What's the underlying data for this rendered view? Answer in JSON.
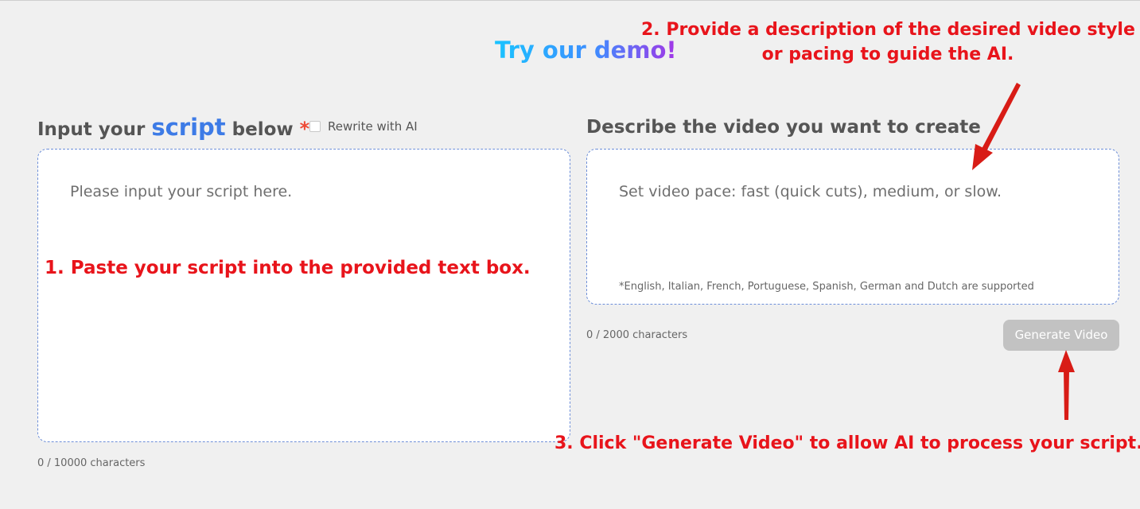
{
  "demo_title": "Try our demo!",
  "left_panel": {
    "title_prefix": "Input your",
    "title_keyword": "script",
    "title_suffix": "below",
    "required_mark": "*",
    "rewrite_label": "Rewrite with AI",
    "placeholder": "Please input your script here.",
    "char_count": "0 / 10000 characters"
  },
  "right_panel": {
    "title": "Describe the video you want to create",
    "placeholder": "Set video pace: fast (quick cuts), medium, or slow.",
    "support_note": "*English, Italian, French, Portuguese, Spanish, German and Dutch are supported",
    "char_count": "0 / 2000 characters",
    "generate_label": "Generate Video"
  },
  "annotations": {
    "step1": "1. Paste your script into the provided text box.",
    "step2_line1": "2. Provide a description of the desired video style",
    "step2_line2": "or pacing to guide the AI.",
    "step3": "3.  Click \"Generate Video\" to allow AI to process your script."
  },
  "colors": {
    "background": "#f0f0f0",
    "annotation_red": "#e8141b",
    "keyword_blue": "#3d7be6",
    "required_red": "#ee4a36",
    "button_disabled": "#c2c2c2",
    "box_border": "#6e8fd8"
  },
  "icons": {
    "arrow_step2": "arrow-down-left-icon",
    "arrow_step3": "arrow-up-icon"
  }
}
